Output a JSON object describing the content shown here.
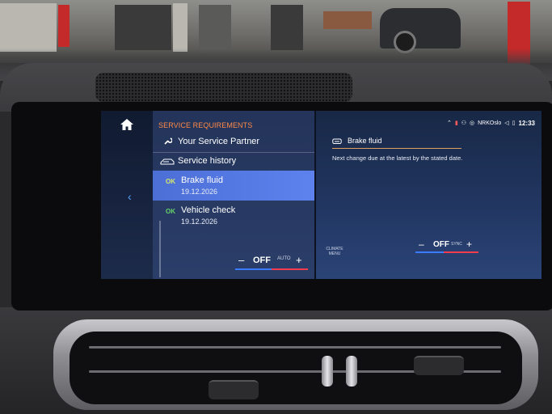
{
  "sidebar": {
    "home_icon": "home-icon",
    "back_icon": "chevron-left-icon"
  },
  "service_panel": {
    "title": "SERVICE REQUIREMENTS",
    "items": [
      {
        "icon": "wrench-icon",
        "label": "Your Service Partner"
      },
      {
        "icon": "car-history-icon",
        "label": "Service history"
      },
      {
        "badge": "OK",
        "label": "Brake fluid",
        "date": "19.12.2026",
        "selected": true
      },
      {
        "badge": "OK",
        "label": "Vehicle check",
        "date": "19.12.2026"
      }
    ]
  },
  "climate_left": {
    "minus": "–",
    "value": "OFF",
    "mode": "AUTO",
    "plus": "+"
  },
  "status_bar": {
    "network": "NRKOslo",
    "time": "12:33"
  },
  "detail": {
    "title": "Brake fluid",
    "text": "Next change due at the latest by the stated date."
  },
  "climate_right": {
    "menu": "CLIMATE MENU",
    "minus": "–",
    "value": "OFF",
    "mode": "SYNC",
    "plus": "+"
  },
  "colors": {
    "accent_orange": "#ff8a47",
    "ok_green": "#66d16a",
    "selected_blue": "#5d82ee"
  }
}
